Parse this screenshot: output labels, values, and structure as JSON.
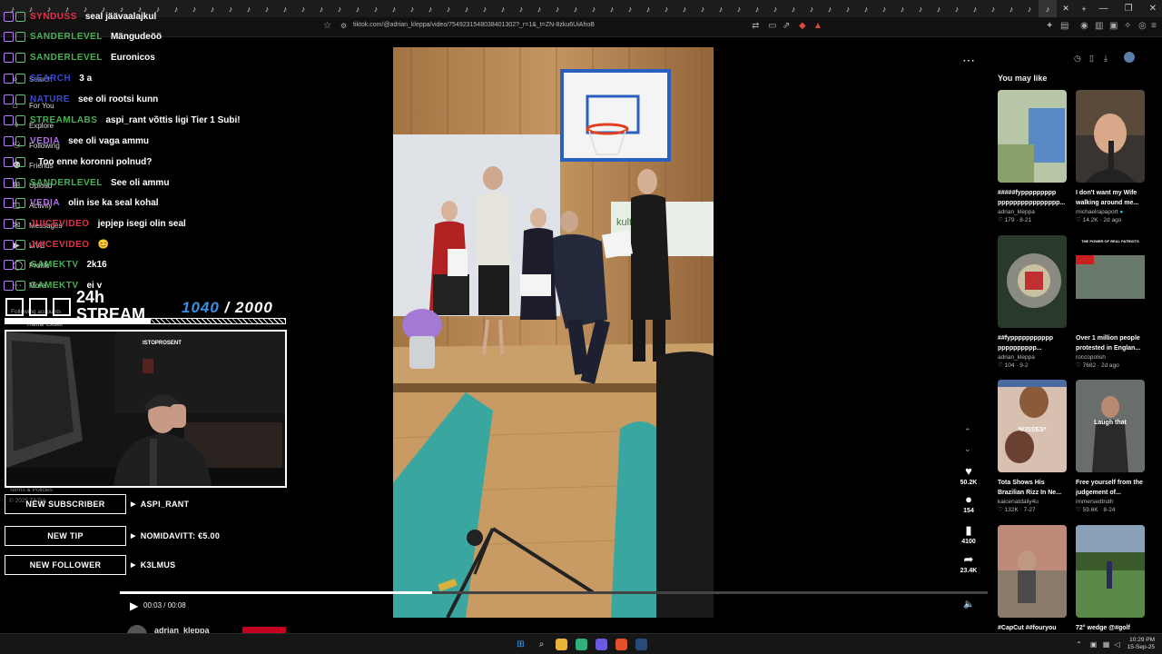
{
  "browser": {
    "url": "tiktok.com/@adrian_kleppa/video/7549231548038401302?_r=1&_t=ZN-8zku6UiAhoB",
    "tab_glyph": "♪",
    "close_glyph": "✕",
    "new_tab_glyph": "+",
    "window_controls": [
      "—",
      "❐",
      "✕"
    ]
  },
  "tiktok_nav": {
    "search": "Search",
    "items": [
      "For You",
      "Explore",
      "Following",
      "Friends",
      "Upload",
      "Activity",
      "Messages",
      "LIVE",
      "Profile",
      "More"
    ],
    "following_accounts_label": "Following accounts",
    "following_account": "Rainar Ekdell",
    "terms": "Terms & Policies",
    "copyright": "© 2025 TikTok"
  },
  "chat": [
    {
      "user": "SYNDUSS",
      "color": "#e0324a",
      "text": "seal jäävaalajkul"
    },
    {
      "user": "SANDERLEVEL",
      "color": "#48b055",
      "text": "Mängudeöö"
    },
    {
      "user": "SANDERLEVEL",
      "color": "#48b055",
      "text": "Euronicos"
    },
    {
      "user": "SEARCH",
      "color": "#3a4ad0",
      "text": "3 a"
    },
    {
      "user": "NATURE",
      "color": "#3a4ad0",
      "text": "see oli rootsi kunn"
    },
    {
      "user": "STREAMLABS",
      "color": "#48b055",
      "text": "aspi_rant võttis ligi Tier 1 Subi!"
    },
    {
      "user": "VEDIA",
      "color": "#b070e0",
      "text": "see oli vaga ammu"
    },
    {
      "user": "",
      "color": "#3a4ad0",
      "text": "Too enne koronni polnud?"
    },
    {
      "user": "SANDERLEVEL",
      "color": "#48b055",
      "text": "See oli ammu"
    },
    {
      "user": "VEDIA",
      "color": "#b070e0",
      "text": "olin ise ka seal kohal"
    },
    {
      "user": "JUICEVIDEO",
      "color": "#e0324a",
      "text": "jepjep isegi olin seal"
    },
    {
      "user": "JUICEVIDEO",
      "color": "#e0324a",
      "text": "😊"
    },
    {
      "user": "GAMEKTV",
      "color": "#48b055",
      "text": "2k16"
    },
    {
      "user": "GAMEKTV",
      "color": "#48b055",
      "text": "ei v"
    }
  ],
  "stream": {
    "title_line1": "24h",
    "title_line2": "STREAM",
    "goal_current": "1040",
    "goal_sep": " / ",
    "goal_total": "2000",
    "goal_fraction": 0.52,
    "webcam_sign": "ISTOPROSENT"
  },
  "alerts": [
    {
      "label": "NEW SUBSCRIBER",
      "value": "ASPI_RANT"
    },
    {
      "label": "NEW TIP",
      "value": "NOMIDAVITT: €5.00"
    },
    {
      "label": "NEW FOLLOWER",
      "value": "K3LMUS"
    }
  ],
  "video": {
    "current_time": "00:03",
    "duration": "00:08",
    "time_sep": " / ",
    "progress_fraction": 0.36,
    "author_below": "adrian_kleppa",
    "banner_text": "kultu"
  },
  "actions": {
    "likes": "50.2K",
    "comments": "154",
    "saves": "4100",
    "shares": "23.4K"
  },
  "you_may_like": {
    "title": "You may like",
    "items": [
      {
        "title": "#####fyppppppppp pppppppppppppppp...",
        "author": "adrian_kleppa",
        "verified": false,
        "likes": "179",
        "date": "8-21"
      },
      {
        "title": "I don't want my Wife walking around me...",
        "author": "michaelrapaport",
        "verified": true,
        "likes": "14.2K",
        "date": "2d ago"
      },
      {
        "title": "##fyppppppppppp pppppppppp...",
        "author": "adrian_kleppa",
        "verified": false,
        "likes": "104",
        "date": "9-2"
      },
      {
        "title": "Over 1 million people protested in Englan...",
        "author": "roccopolish",
        "verified": false,
        "likes": "7682",
        "date": "2d ago",
        "overlay": "THE POWER OF REAL PATRIOTS"
      },
      {
        "title": "Tota Shows His Brazilian Rizz In Ne...",
        "author": "kaicenatdaily4u",
        "verified": false,
        "likes": "132K",
        "date": "7-27",
        "overlay": "*KISSES*"
      },
      {
        "title": "Free yourself from the judgement of...",
        "author": "immersedtruth",
        "verified": false,
        "likes": "59.6K",
        "date": "8-24",
        "overlay": "Laugh that"
      },
      {
        "title": "#CapCut ##fouryou",
        "author": "",
        "verified": false,
        "likes": "",
        "date": ""
      },
      {
        "title": "72° wedge @#golf",
        "author": "",
        "verified": false,
        "likes": "",
        "date": ""
      }
    ]
  },
  "taskbar": {
    "time": "10:29 PM",
    "date": "15-Sep-25"
  }
}
